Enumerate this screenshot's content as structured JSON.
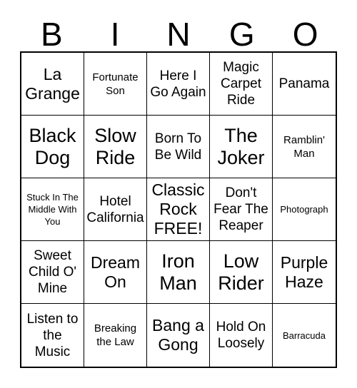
{
  "header": {
    "letters": [
      "B",
      "I",
      "N",
      "G",
      "O"
    ]
  },
  "grid": {
    "rows": 5,
    "columns": 5,
    "free_space_index": 12,
    "text_color": "#000000",
    "background_color": "#ffffff",
    "border_color": "#000000",
    "cells": [
      {
        "text": "La Grange",
        "size": "lg"
      },
      {
        "text": "Fortunate Son",
        "size": "sm"
      },
      {
        "text": "Here I Go Again",
        "size": "md"
      },
      {
        "text": "Magic Carpet Ride",
        "size": "md"
      },
      {
        "text": "Panama",
        "size": "md"
      },
      {
        "text": "Black Dog",
        "size": "xl"
      },
      {
        "text": "Slow Ride",
        "size": "xl"
      },
      {
        "text": "Born To Be Wild",
        "size": "md"
      },
      {
        "text": "The Joker",
        "size": "xl"
      },
      {
        "text": "Ramblin' Man",
        "size": "sm"
      },
      {
        "text": "Stuck In The Middle With You",
        "size": "xs"
      },
      {
        "text": "Hotel California",
        "size": "md"
      },
      {
        "text": "Classic Rock FREE!",
        "size": "lg"
      },
      {
        "text": "Don't Fear The Reaper",
        "size": "md"
      },
      {
        "text": "Photograph",
        "size": "xs"
      },
      {
        "text": "Sweet Child O' Mine",
        "size": "md"
      },
      {
        "text": "Dream On",
        "size": "lg"
      },
      {
        "text": "Iron Man",
        "size": "xl"
      },
      {
        "text": "Low Rider",
        "size": "xl"
      },
      {
        "text": "Purple Haze",
        "size": "lg"
      },
      {
        "text": "Listen to the Music",
        "size": "md"
      },
      {
        "text": "Breaking the Law",
        "size": "sm"
      },
      {
        "text": "Bang a Gong",
        "size": "lg"
      },
      {
        "text": "Hold On Loosely",
        "size": "md"
      },
      {
        "text": "Barracuda",
        "size": "xs"
      }
    ]
  }
}
